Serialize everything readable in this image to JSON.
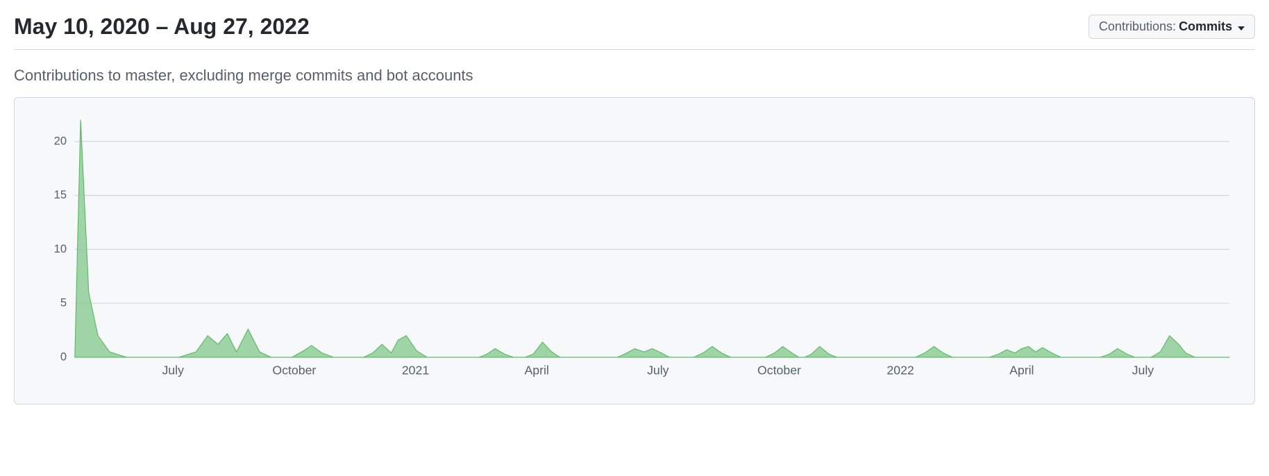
{
  "header": {
    "date_range": "May 10, 2020 – Aug 27, 2022",
    "dropdown_label": "Contributions: ",
    "dropdown_value": "Commits"
  },
  "subtitle": "Contributions to master, excluding merge commits and bot accounts",
  "chart_data": {
    "type": "area",
    "title": "",
    "xlabel": "",
    "ylabel": "",
    "ylim": [
      0,
      22
    ],
    "y_ticks": [
      0,
      5,
      10,
      15,
      20
    ],
    "x_ticks": [
      "July",
      "October",
      "2021",
      "April",
      "July",
      "October",
      "2022",
      "April",
      "July"
    ],
    "x_tick_positions": [
      0.085,
      0.19,
      0.295,
      0.4,
      0.505,
      0.61,
      0.715,
      0.82,
      0.925
    ],
    "series": [
      {
        "name": "commits",
        "points": [
          [
            0.0,
            0
          ],
          [
            0.005,
            22
          ],
          [
            0.012,
            6
          ],
          [
            0.02,
            2
          ],
          [
            0.03,
            0.5
          ],
          [
            0.045,
            0
          ],
          [
            0.07,
            0
          ],
          [
            0.09,
            0
          ],
          [
            0.105,
            0.5
          ],
          [
            0.115,
            2
          ],
          [
            0.124,
            1.2
          ],
          [
            0.132,
            2.2
          ],
          [
            0.14,
            0.5
          ],
          [
            0.15,
            2.6
          ],
          [
            0.16,
            0.5
          ],
          [
            0.17,
            0
          ],
          [
            0.188,
            0
          ],
          [
            0.198,
            0.6
          ],
          [
            0.205,
            1.1
          ],
          [
            0.214,
            0.4
          ],
          [
            0.224,
            0
          ],
          [
            0.25,
            0
          ],
          [
            0.258,
            0.4
          ],
          [
            0.266,
            1.2
          ],
          [
            0.274,
            0.4
          ],
          [
            0.28,
            1.6
          ],
          [
            0.287,
            2.0
          ],
          [
            0.296,
            0.6
          ],
          [
            0.305,
            0
          ],
          [
            0.35,
            0
          ],
          [
            0.357,
            0.3
          ],
          [
            0.364,
            0.8
          ],
          [
            0.372,
            0.3
          ],
          [
            0.38,
            0
          ],
          [
            0.39,
            0
          ],
          [
            0.397,
            0.3
          ],
          [
            0.405,
            1.4
          ],
          [
            0.413,
            0.5
          ],
          [
            0.42,
            0
          ],
          [
            0.47,
            0
          ],
          [
            0.478,
            0.4
          ],
          [
            0.485,
            0.8
          ],
          [
            0.493,
            0.5
          ],
          [
            0.5,
            0.8
          ],
          [
            0.508,
            0.4
          ],
          [
            0.515,
            0
          ],
          [
            0.536,
            0
          ],
          [
            0.544,
            0.4
          ],
          [
            0.552,
            1.0
          ],
          [
            0.56,
            0.4
          ],
          [
            0.568,
            0
          ],
          [
            0.598,
            0
          ],
          [
            0.606,
            0.4
          ],
          [
            0.613,
            1.0
          ],
          [
            0.621,
            0.4
          ],
          [
            0.627,
            0
          ],
          [
            0.632,
            0
          ],
          [
            0.638,
            0.3
          ],
          [
            0.645,
            1.0
          ],
          [
            0.653,
            0.3
          ],
          [
            0.66,
            0
          ],
          [
            0.728,
            0
          ],
          [
            0.736,
            0.4
          ],
          [
            0.744,
            1.0
          ],
          [
            0.752,
            0.4
          ],
          [
            0.76,
            0
          ],
          [
            0.792,
            0
          ],
          [
            0.8,
            0.3
          ],
          [
            0.807,
            0.7
          ],
          [
            0.814,
            0.4
          ],
          [
            0.82,
            0.8
          ],
          [
            0.826,
            1.0
          ],
          [
            0.832,
            0.5
          ],
          [
            0.838,
            0.9
          ],
          [
            0.846,
            0.4
          ],
          [
            0.854,
            0
          ],
          [
            0.888,
            0
          ],
          [
            0.896,
            0.3
          ],
          [
            0.903,
            0.8
          ],
          [
            0.911,
            0.3
          ],
          [
            0.918,
            0
          ],
          [
            0.932,
            0
          ],
          [
            0.94,
            0.5
          ],
          [
            0.948,
            2.0
          ],
          [
            0.956,
            1.2
          ],
          [
            0.962,
            0.4
          ],
          [
            0.97,
            0
          ],
          [
            1.0,
            0
          ]
        ]
      }
    ],
    "colors": {
      "area_fill": "#8fcf96",
      "area_stroke": "#5fb869"
    }
  }
}
